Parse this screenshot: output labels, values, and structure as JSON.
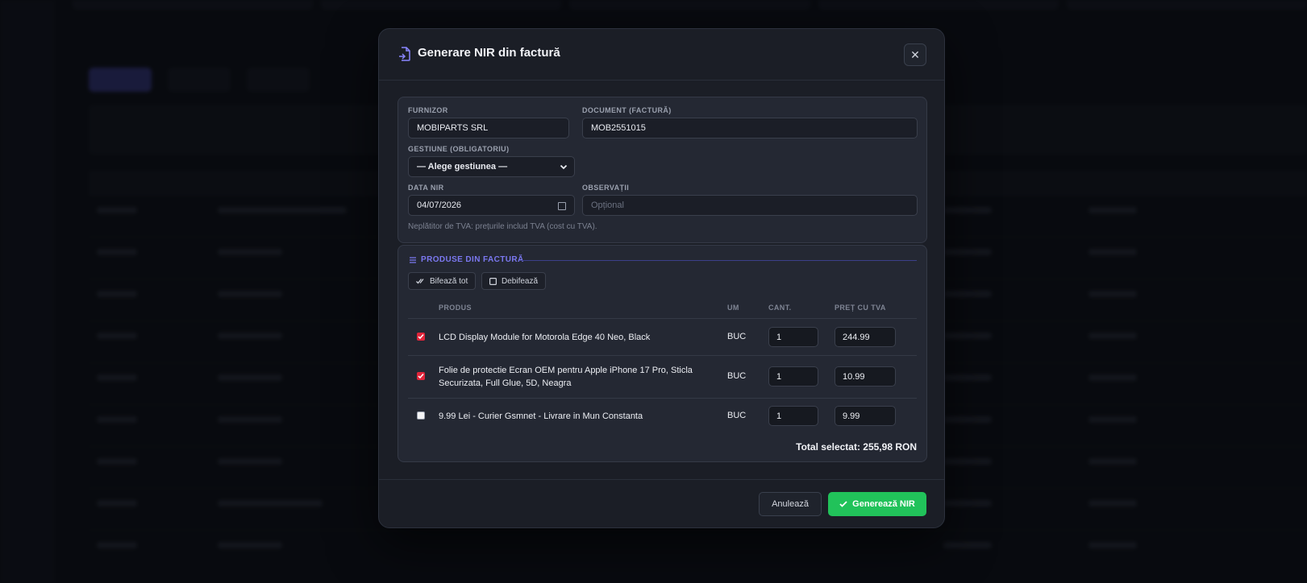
{
  "modal": {
    "title": "Generare NIR din factură",
    "close_symbol": "✕"
  },
  "form": {
    "supplier_label": "FURNIZOR",
    "supplier_value": "MOBIPARTS SRL",
    "document_label": "DOCUMENT (FACTURĂ)",
    "document_value": "MOB2551015",
    "gestiune_label": "GESTIUNE (OBLIGATORIU)",
    "gestiune_value": "— Alege gestiunea —",
    "date_label": "DATA NIR",
    "date_value": "04/07/2026",
    "notes_label": "OBSERVAȚII",
    "notes_placeholder": "Opțional",
    "hint": "Neplătitor de TVA: prețurile includ TVA (cost cu TVA)."
  },
  "products": {
    "section_title": "PRODUSE DIN FACTURĂ",
    "check_all": "Bifează tot",
    "uncheck_all": "Debifează",
    "columns": [
      "PRODUS",
      "UM",
      "CANT.",
      "PREȚ CU TVA"
    ],
    "rows": [
      {
        "checked": true,
        "name": "LCD Display Module for Motorola Edge 40 Neo, Black",
        "um": "BUC",
        "qty": "1",
        "price": "244.99"
      },
      {
        "checked": true,
        "name": "Folie de protectie Ecran OEM pentru Apple iPhone 17 Pro, Sticla Securizata, Full Glue, 5D, Neagra",
        "um": "BUC",
        "qty": "1",
        "price": "10.99"
      },
      {
        "checked": false,
        "name": "9.99 Lei - Curier Gsmnet - Livrare in Mun Constanta",
        "um": "BUC",
        "qty": "1",
        "price": "9.99"
      }
    ],
    "total": "Total selectat: 255,98 RON"
  },
  "footer": {
    "cancel": "Anulează",
    "generate": "Generează NIR"
  },
  "colors": {
    "accent": "#7b78f0",
    "success": "#21c25a",
    "checkbox": "#e0243a"
  }
}
